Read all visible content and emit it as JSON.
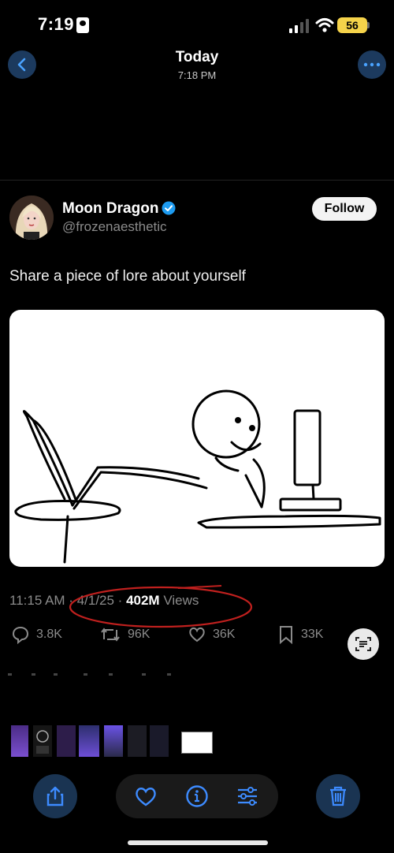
{
  "status_bar": {
    "time": "7:19",
    "battery": "56"
  },
  "header": {
    "title": "Today",
    "subtitle": "7:18 PM"
  },
  "tweet": {
    "name": "Moon Dragon",
    "handle": "@frozenaesthetic",
    "follow_label": "Follow",
    "text": "Share a piece of lore about yourself",
    "time": "11:15 AM",
    "sep1": " · ",
    "date": "4/1/25",
    "sep2": " · ",
    "views_count": "402M",
    "views_label": " Views",
    "replies": "3.8K",
    "retweets": "96K",
    "likes": "36K",
    "bookmarks": "33K"
  },
  "colors": {
    "accent": "#1d9bf0",
    "annotation": "#c0201e",
    "battery": "#f5d34a"
  },
  "icons": [
    "back-arrow-icon",
    "more-icon",
    "verified-icon",
    "reply-icon",
    "retweet-icon",
    "like-icon",
    "bookmark-icon",
    "text-scan-icon",
    "share-icon",
    "heart-icon",
    "info-icon",
    "adjust-icon",
    "trash-icon"
  ]
}
